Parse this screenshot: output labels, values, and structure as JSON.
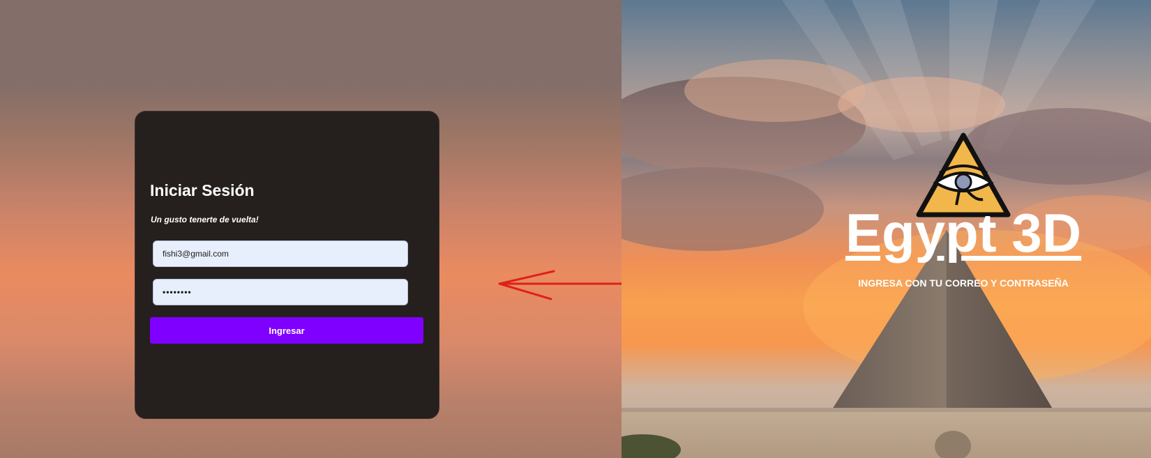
{
  "login": {
    "title": "Iniciar Sesión",
    "subtitle": "Un gusto tenerte de vuelta!",
    "email_value": "fishi3@gmail.com",
    "password_value": "••••••••",
    "submit_label": "Ingresar"
  },
  "hero": {
    "brand_title": "Egypt 3D",
    "tagline": "INGRESA CON TU CORREO Y CONTRASEÑA",
    "logo_icon": "eye-of-horus-pyramid-icon"
  },
  "annotation": {
    "arrow_icon": "left-arrow-icon",
    "arrow_color": "#e0201a"
  },
  "colors": {
    "card_bg": "#251f1e",
    "button_bg": "#7f00ff",
    "input_bg": "#e8effc"
  }
}
